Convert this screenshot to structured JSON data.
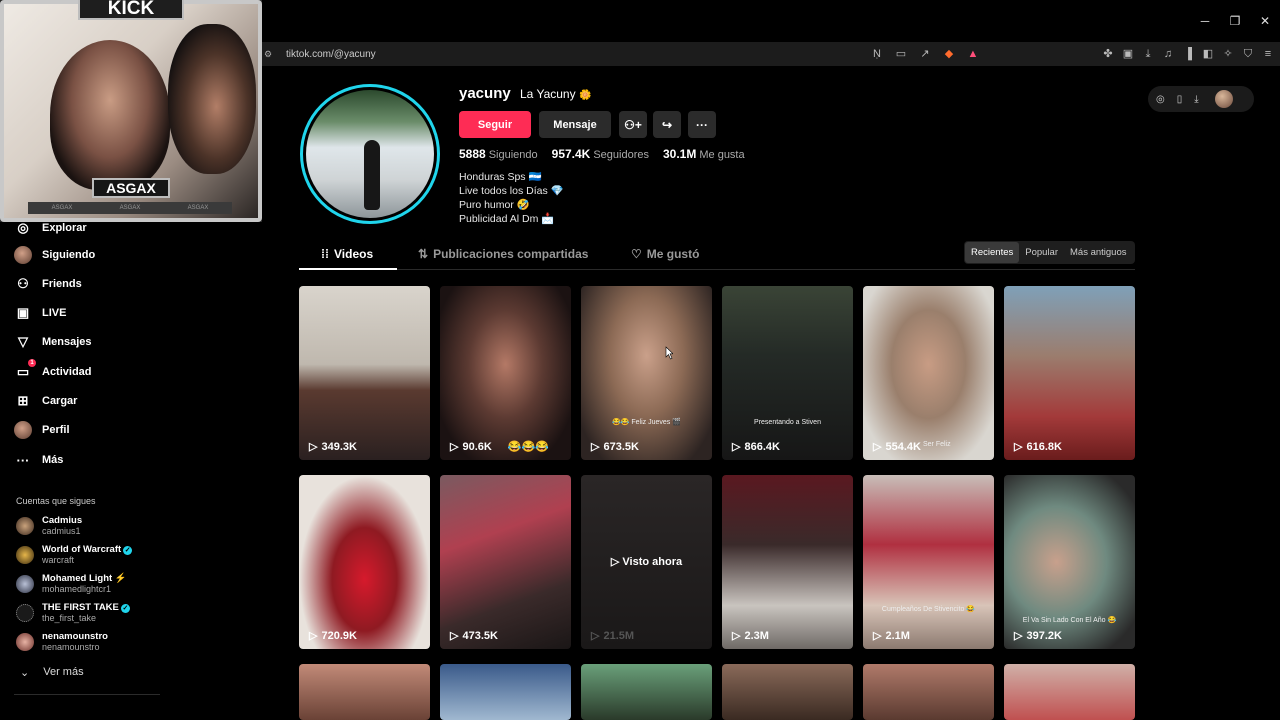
{
  "overlay": {
    "kick_label": "KICK",
    "streamer_label": "ASGAX",
    "strip": [
      "ASGAX",
      "ASGAX",
      "ASGAX"
    ]
  },
  "browser": {
    "url": "tiktok.com/@yacuny",
    "window_controls": [
      "─",
      "❐",
      "✕"
    ]
  },
  "sidebar": {
    "items": [
      {
        "label": "Explorar",
        "icon": "compass-icon"
      },
      {
        "label": "Siguiendo",
        "icon": "avatar-icon"
      },
      {
        "label": "Friends",
        "icon": "friends-icon"
      },
      {
        "label": "LIVE",
        "icon": "live-icon"
      },
      {
        "label": "Mensajes",
        "icon": "send-icon"
      },
      {
        "label": "Actividad",
        "icon": "activity-icon",
        "badge": "1"
      },
      {
        "label": "Cargar",
        "icon": "plus-square-icon"
      },
      {
        "label": "Perfil",
        "icon": "avatar-icon"
      },
      {
        "label": "Más",
        "icon": "more-icon"
      }
    ],
    "following_title": "Cuentas que sigues",
    "following": [
      {
        "name": "Cadmius",
        "handle": "cadmius1",
        "verified": false,
        "extra": ""
      },
      {
        "name": "World of Warcraft",
        "handle": "warcraft",
        "verified": true,
        "extra": ""
      },
      {
        "name": "Mohamed Light",
        "handle": "mohamedlightcr1",
        "verified": false,
        "extra": "⚡"
      },
      {
        "name": "THE FIRST TAKE",
        "handle": "the_first_take",
        "verified": true,
        "extra": ""
      },
      {
        "name": "nenamounstro",
        "handle": "nenamounstro",
        "verified": false,
        "extra": ""
      }
    ],
    "see_more": "Ver más"
  },
  "profile": {
    "username": "yacuny",
    "display_name": "La Yacuny",
    "display_emoji": "🌼",
    "follow_label": "Seguir",
    "message_label": "Mensaje",
    "stats": [
      {
        "value": "5888",
        "label": "Siguiendo"
      },
      {
        "value": "957.4K",
        "label": "Seguidores"
      },
      {
        "value": "30.1M",
        "label": "Me gusta"
      }
    ],
    "bio": [
      "Honduras Sps 🇭🇳",
      "Live todos los Días 💎",
      "Puro humor 🤣",
      "Publicidad Al Dm 📩"
    ]
  },
  "tabs": [
    {
      "label": "Videos",
      "icon": "grid-icon"
    },
    {
      "label": "Publicaciones compartidas",
      "icon": "repost-icon"
    },
    {
      "label": "Me gustó",
      "icon": "heart-icon"
    }
  ],
  "sort": [
    "Recientes",
    "Popular",
    "Más antiguos"
  ],
  "videos": [
    {
      "views": "349.3K",
      "caption": "",
      "extra": ""
    },
    {
      "views": "90.6K",
      "caption": "",
      "extra": "😂😂😂"
    },
    {
      "views": "673.5K",
      "caption": "😂😂 Feliz Jueves 🎬",
      "extra": ""
    },
    {
      "views": "866.4K",
      "caption": "Presentando a Stiven",
      "extra": ""
    },
    {
      "views": "554.4K",
      "caption": "Ser Feliz",
      "extra": ""
    },
    {
      "views": "616.8K",
      "caption": "",
      "extra": ""
    },
    {
      "views": "720.9K",
      "caption": "",
      "extra": ""
    },
    {
      "views": "473.5K",
      "caption": "",
      "extra": ""
    },
    {
      "views": "21.5M",
      "caption": "",
      "extra": "",
      "watched": "Visto ahora"
    },
    {
      "views": "2.3M",
      "caption": "",
      "extra": ""
    },
    {
      "views": "2.1M",
      "caption": "Cumpleaños De Stivencito 😂",
      "extra": ""
    },
    {
      "views": "397.2K",
      "caption": "El Va Sin Lado Con El Año 😂",
      "extra": ""
    }
  ]
}
